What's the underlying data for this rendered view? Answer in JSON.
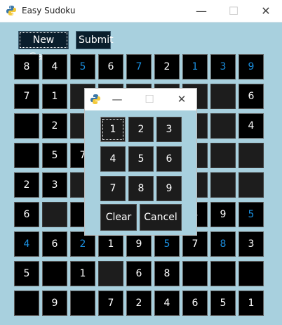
{
  "window": {
    "title": "Easy Sudoku",
    "minimize": "—",
    "maximize": "☐",
    "close": "✕"
  },
  "toolbar": {
    "new_game": "New Game",
    "submit": "Submit"
  },
  "grid": [
    [
      "8",
      "4",
      "5",
      "6",
      "7",
      "2",
      "1",
      "3",
      "9"
    ],
    [
      "7",
      "1",
      "",
      "",
      "",
      "",
      "",
      "",
      "6"
    ],
    [
      "",
      "2",
      "",
      "",
      "",
      "",
      "",
      "",
      "4"
    ],
    [
      "",
      "5",
      "7",
      "",
      "",
      "",
      "",
      "",
      ""
    ],
    [
      "2",
      "3",
      "",
      "",
      "",
      "",
      "",
      "",
      ""
    ],
    [
      "6",
      "",
      "",
      "",
      "",
      "",
      "3",
      "9",
      "5"
    ],
    [
      "4",
      "6",
      "2",
      "1",
      "9",
      "5",
      "7",
      "8",
      "3"
    ],
    [
      "5",
      "",
      "1",
      "",
      "6",
      "8",
      "",
      "",
      ""
    ],
    [
      "",
      "9",
      "",
      "7",
      "2",
      "4",
      "6",
      "5",
      "1"
    ]
  ],
  "blue_cells": [
    [
      0,
      2
    ],
    [
      0,
      4
    ],
    [
      0,
      6
    ],
    [
      0,
      7
    ],
    [
      0,
      8
    ],
    [
      5,
      8
    ],
    [
      6,
      0
    ],
    [
      6,
      2
    ],
    [
      6,
      5
    ],
    [
      6,
      7
    ]
  ],
  "dark_empty_cells": [
    [
      2,
      0
    ],
    [
      3,
      0
    ],
    [
      5,
      2
    ],
    [
      7,
      1
    ],
    [
      7,
      6
    ],
    [
      7,
      7
    ],
    [
      7,
      8
    ],
    [
      8,
      0
    ],
    [
      8,
      2
    ]
  ],
  "gray_empty_cells": [
    [
      3,
      6
    ],
    [
      3,
      7
    ],
    [
      3,
      8
    ],
    [
      4,
      6
    ],
    [
      4,
      7
    ],
    [
      4,
      8
    ],
    [
      7,
      3
    ]
  ],
  "dialog": {
    "minimize": "—",
    "maximize": "☐",
    "close": "✕",
    "keys": [
      "1",
      "2",
      "3",
      "4",
      "5",
      "6",
      "7",
      "8",
      "9"
    ],
    "clear": "Clear",
    "cancel": "Cancel"
  },
  "colors": {
    "background": "#a8d0de",
    "cell": "#000000",
    "blue_digit": "#1a8fe0"
  }
}
